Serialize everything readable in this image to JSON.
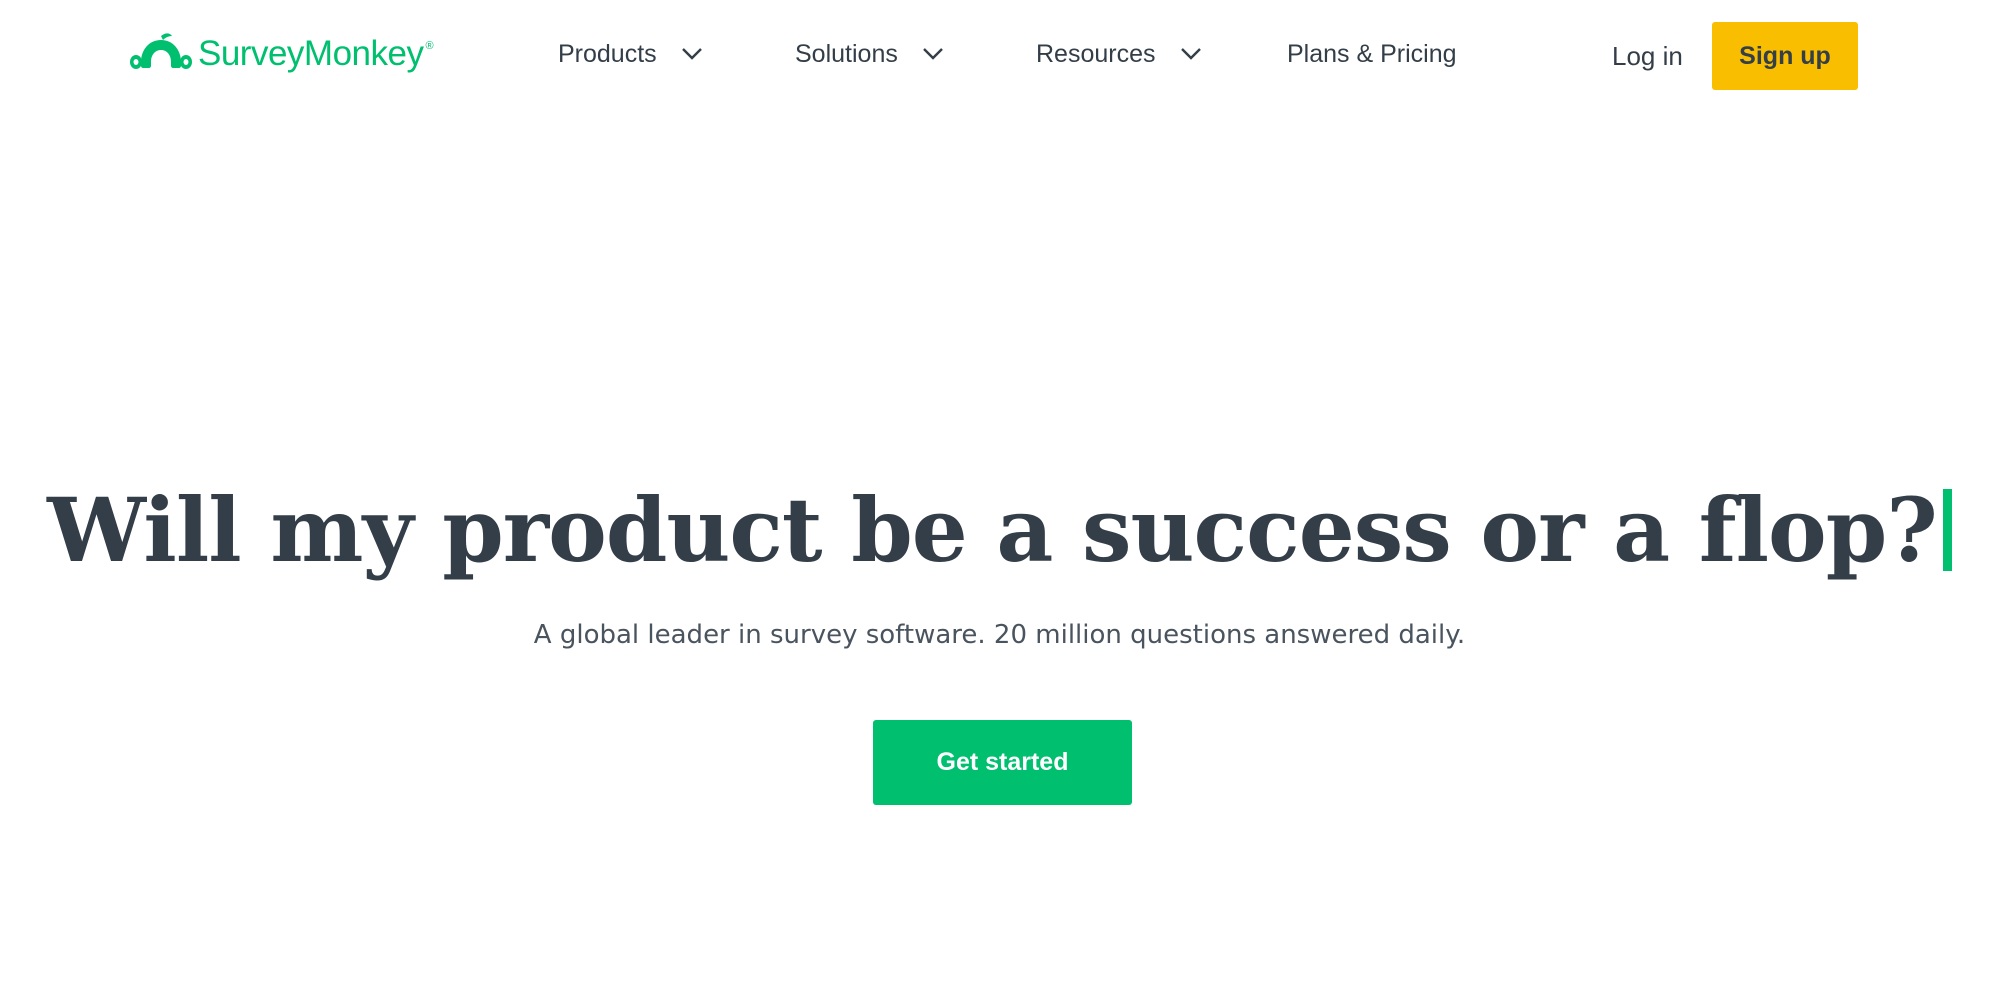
{
  "brand": {
    "name": "SurveyMonkey",
    "registered_mark": "®",
    "logo_icon": "monkey-logo-icon",
    "color": "#00bf6f"
  },
  "nav": {
    "items": [
      {
        "label": "Products",
        "has_dropdown": true,
        "icon": "chevron-down-icon"
      },
      {
        "label": "Solutions",
        "has_dropdown": true,
        "icon": "chevron-down-icon"
      },
      {
        "label": "Resources",
        "has_dropdown": true,
        "icon": "chevron-down-icon"
      },
      {
        "label": "Plans & Pricing",
        "has_dropdown": false
      }
    ],
    "login_label": "Log in",
    "signup_label": "Sign up",
    "signup_color": "#f9be00"
  },
  "hero": {
    "title": "Will my product be a success or a flop?",
    "subtitle": "A global leader in survey software. 20 million questions answered daily.",
    "cta_label": "Get started",
    "cta_color": "#00bf6f",
    "caret_color": "#00bf6f"
  },
  "colors": {
    "text": "#333e48",
    "background": "#ffffff"
  }
}
